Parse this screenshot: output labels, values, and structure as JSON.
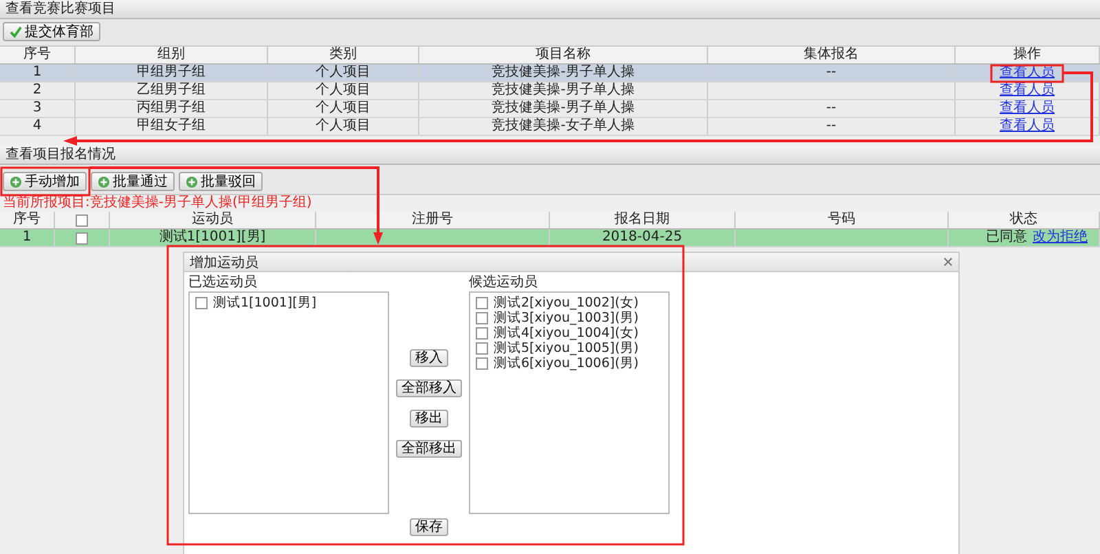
{
  "projects": {
    "title": "查看竞赛比赛项目",
    "toolbar": [
      {
        "label": "提交体育部",
        "kind": "submit"
      }
    ],
    "columns": [
      "序号",
      "组别",
      "类别",
      "项目名称",
      "集体报名",
      "操作"
    ],
    "rows": [
      {
        "no": "1",
        "group": "甲组男子组",
        "category": "个人项目",
        "name": "竞技健美操-男子单人操",
        "team": "--",
        "action": "查看人员",
        "selected": true
      },
      {
        "no": "2",
        "group": "乙组男子组",
        "category": "个人项目",
        "name": "竞技健美操-男子单人操",
        "action": "查看人员",
        "selected": false
      },
      {
        "no": "3",
        "group": "丙组男子组",
        "category": "个人项目",
        "name": "竞技健美操-男子单人操",
        "team": "--",
        "action": "查看人员",
        "selected": false
      },
      {
        "no": "4",
        "group": "甲组女子组",
        "category": "个人项目",
        "name": "竞技健美操-女子单人操",
        "team": "--",
        "action": "查看人员",
        "selected": false
      }
    ]
  },
  "registrations": {
    "title": "查看项目报名情况",
    "toolbar": [
      {
        "label": "手动增加",
        "kind": "add"
      },
      {
        "label": "批量通过",
        "kind": "add"
      },
      {
        "label": "批量驳回",
        "kind": "add"
      }
    ],
    "current_project": "当前所报项目:竞技健美操-男子单人操(甲组男子组)",
    "columns": [
      {
        "kind": "text",
        "label": "序号"
      },
      {
        "kind": "checkbox",
        "checked": false
      },
      {
        "kind": "text",
        "label": "运动员"
      },
      {
        "kind": "text",
        "label": "注册号"
      },
      {
        "kind": "text",
        "label": "报名日期"
      },
      {
        "kind": "text",
        "label": "号码"
      },
      {
        "kind": "text",
        "label": "状态"
      }
    ],
    "rows": [
      {
        "no": "1",
        "checked": false,
        "athlete": "测试1[1001][男]",
        "date": "2018-04-25",
        "status": "已同意",
        "action": "改为拒绝",
        "selected": true
      }
    ]
  },
  "dialog": {
    "title": "增加运动员",
    "selected_label": "已选运动员",
    "selected_items": [
      {
        "label": "测试1[1001][男]",
        "checked": false
      }
    ],
    "candidate_label": "候选运动员",
    "candidate_items": [
      {
        "label": "测试2[xiyou_1002](女)",
        "checked": false
      },
      {
        "label": "测试3[xiyou_1003](男)",
        "checked": false
      },
      {
        "label": "测试4[xiyou_1004](女)",
        "checked": false
      },
      {
        "label": "测试5[xiyou_1005](男)",
        "checked": false
      },
      {
        "label": "测试6[xiyou_1006](男)",
        "checked": false
      }
    ],
    "transfer_buttons": [
      "移入",
      "全部移入",
      "移出",
      "全部移出"
    ],
    "save_button": "保存"
  }
}
